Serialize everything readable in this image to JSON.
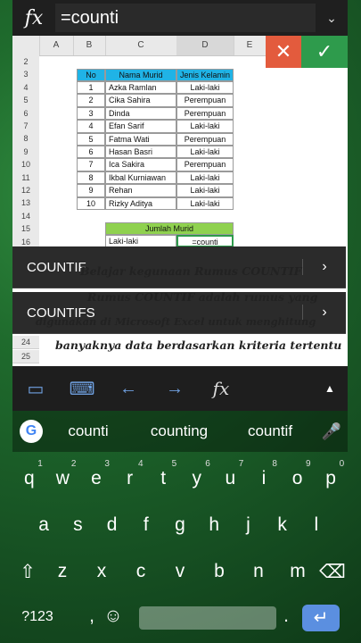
{
  "formula": {
    "fx": "fx",
    "value": "=counti"
  },
  "columns": [
    "A",
    "B",
    "C",
    "D",
    "E"
  ],
  "rows": [
    "2",
    "3",
    "4",
    "5",
    "6",
    "7",
    "8",
    "9",
    "10",
    "11",
    "12",
    "13",
    "14",
    "15",
    "16"
  ],
  "table": {
    "headers": [
      "No",
      "Nama Murid",
      "Jenis Kelamin"
    ],
    "data": [
      [
        "1",
        "Azka Ramlan",
        "Laki-laki"
      ],
      [
        "2",
        "Cika Sahira",
        "Perempuan"
      ],
      [
        "3",
        "Dinda",
        "Perempuan"
      ],
      [
        "4",
        "Efan Sarif",
        "Laki-laki"
      ],
      [
        "5",
        "Fatma Wati",
        "Perempuan"
      ],
      [
        "6",
        "Hasan Basri",
        "Laki-laki"
      ],
      [
        "7",
        "Ica Sakira",
        "Perempuan"
      ],
      [
        "8",
        "Ikbal Kurniawan",
        "Laki-laki"
      ],
      [
        "9",
        "Rehan",
        "Laki-laki"
      ],
      [
        "10",
        "Rizky Aditya",
        "Laki-laki"
      ]
    ],
    "summary_header": "Jumlah Murid",
    "summary_label": "Laki-laki",
    "summary_input": "=counti"
  },
  "suggestions": [
    "COUNTIF",
    "COUNTIFS"
  ],
  "extra_rows": [
    "24",
    "25"
  ],
  "overlay_lines": [
    "Belajar kegunaan Rumus COUNTIF",
    "Rumus COUNTIF adalah rumus yang",
    "digunakan di Microsoft Excel untuk menghitung",
    "banyaknya data berdasarkan kriteria tertentu"
  ],
  "keyboard": {
    "suggest": [
      "counti",
      "counting",
      "countif"
    ],
    "row1": [
      "q",
      "w",
      "e",
      "r",
      "t",
      "y",
      "u",
      "i",
      "o",
      "p"
    ],
    "row1_nums": [
      "1",
      "2",
      "3",
      "4",
      "5",
      "6",
      "7",
      "8",
      "9",
      "0"
    ],
    "row2": [
      "a",
      "s",
      "d",
      "f",
      "g",
      "h",
      "j",
      "k",
      "l"
    ],
    "row3": [
      "z",
      "x",
      "c",
      "v",
      "b",
      "n",
      "m"
    ],
    "sym": "?123",
    "emoji": "☺",
    "comma": ",",
    "period": "."
  },
  "colors": {
    "accent_blue": "#20b3e6",
    "green_header": "#8fd14f",
    "cancel": "#e35b3d",
    "confirm": "#2e9b4c"
  }
}
